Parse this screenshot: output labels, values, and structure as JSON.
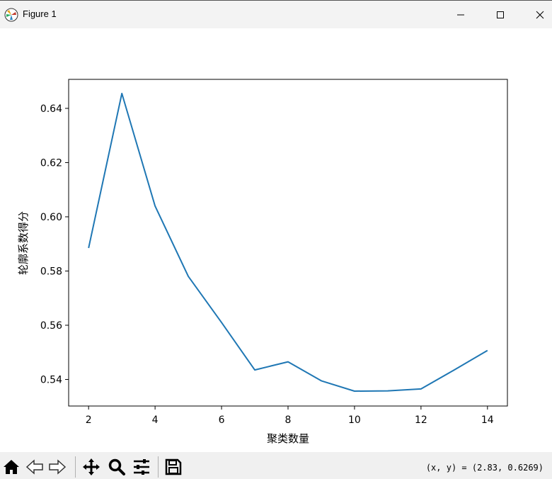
{
  "window": {
    "title": "Figure 1",
    "icon": "matplotlib-icon"
  },
  "chart_data": {
    "type": "line",
    "title": "",
    "xlabel": "聚类数量",
    "ylabel": "轮廓系数得分",
    "x": [
      2,
      3,
      4,
      5,
      6,
      7,
      8,
      9,
      10,
      11,
      12,
      13,
      14
    ],
    "series": [
      {
        "values": [
          0.5885,
          0.6455,
          0.604,
          0.578,
          0.561,
          0.5435,
          0.5465,
          0.5395,
          0.5357,
          0.5358,
          0.5365,
          0.5435,
          0.5507
        ],
        "color": "#1f77b4"
      }
    ],
    "xlim": [
      1.4,
      14.6
    ],
    "ylim": [
      0.5302,
      0.6507
    ],
    "xticks": [
      "2",
      "4",
      "6",
      "8",
      "10",
      "12",
      "14"
    ],
    "xtick_values": [
      2,
      4,
      6,
      8,
      10,
      12,
      14
    ],
    "yticks": [
      "0.54",
      "0.56",
      "0.58",
      "0.60",
      "0.62",
      "0.64"
    ],
    "ytick_values": [
      0.54,
      0.56,
      0.58,
      0.6,
      0.62,
      0.64
    ],
    "grid": false,
    "legend": "none"
  },
  "toolbar": {
    "tools": [
      "home-icon",
      "back-icon",
      "forward-icon",
      "pan-icon",
      "zoom-icon",
      "configure-subplots-icon",
      "save-icon"
    ],
    "coords": "(x, y) = (2.83, 0.6269)"
  }
}
